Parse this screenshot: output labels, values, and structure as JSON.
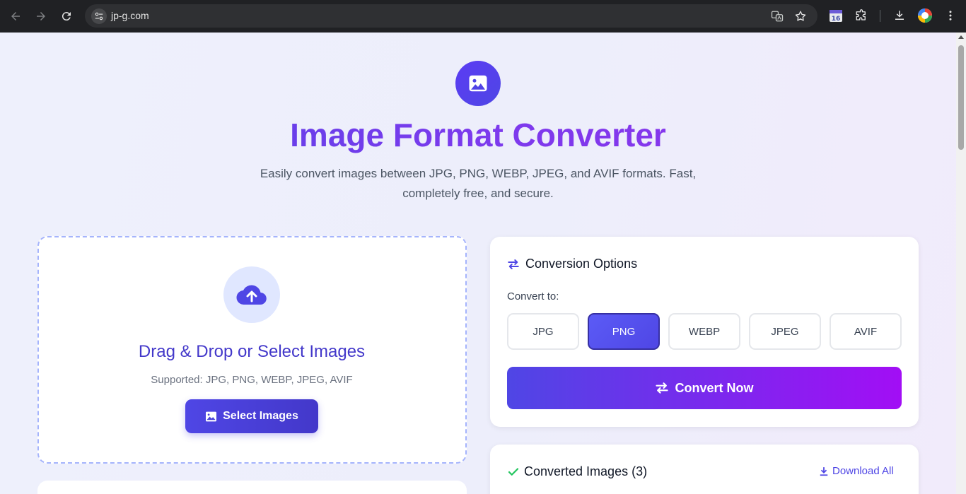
{
  "browser": {
    "url": "jp-g.com",
    "calendar_badge": "16"
  },
  "hero": {
    "title": "Image Format Converter",
    "subtitle": "Easily convert images between JPG, PNG, WEBP, JPEG, and AVIF formats. Fast, completely free, and secure."
  },
  "upload": {
    "title": "Drag & Drop or Select Images",
    "supported": "Supported: JPG, PNG, WEBP, JPEG, AVIF",
    "button_label": "Select Images"
  },
  "options": {
    "heading": "Conversion Options",
    "convert_to_label": "Convert to:",
    "formats": [
      "JPG",
      "PNG",
      "WEBP",
      "JPEG",
      "AVIF"
    ],
    "selected_format": "PNG",
    "convert_button_label": "Convert Now"
  },
  "converted": {
    "heading": "Converted Images (3)",
    "download_all_label": "Download All"
  },
  "colors": {
    "accent": "#4f46e5",
    "accent_purple": "#a20ef5",
    "success": "#22c55e"
  }
}
